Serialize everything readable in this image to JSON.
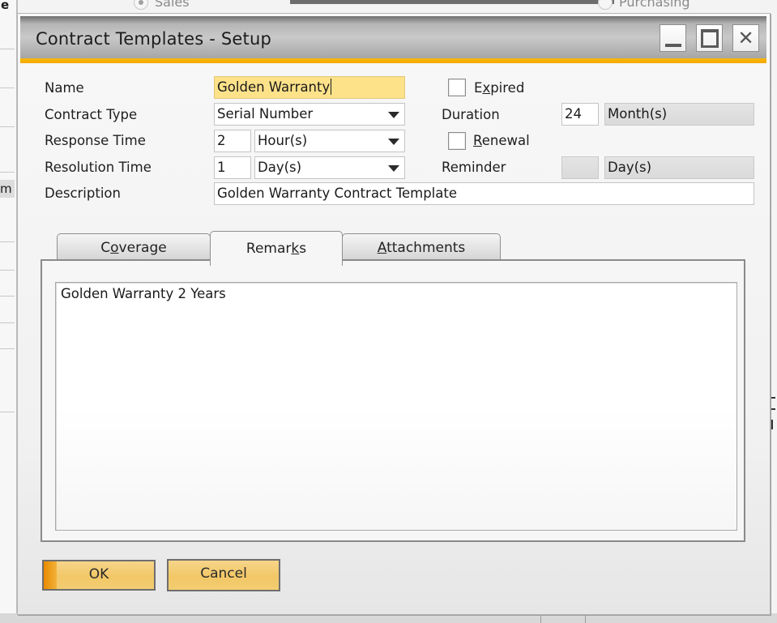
{
  "background": {
    "radio_sales": "Sales",
    "radio_purchasing": "Purchasing",
    "left_col_letter_top": "e",
    "left_col_letter_mid": "m"
  },
  "dialog": {
    "title": "Contract Templates - Setup",
    "window_controls": {
      "minimize": "minimize-icon",
      "maximize": "maximize-icon",
      "close": "close-icon"
    },
    "accent_color": "#f5a800"
  },
  "form": {
    "name": {
      "label": "Name",
      "value": "Golden Warranty"
    },
    "contract_type": {
      "label": "Contract Type",
      "value": "Serial Number"
    },
    "response_time": {
      "label": "Response Time",
      "value": "2",
      "unit": "Hour(s)"
    },
    "resolution_time": {
      "label": "Resolution Time",
      "value": "1",
      "unit": "Day(s)"
    },
    "description": {
      "label": "Description",
      "value": "Golden Warranty Contract Template"
    },
    "expired": {
      "label_pre": "E",
      "label_ul": "x",
      "label_post": "pired",
      "checked": false
    },
    "duration": {
      "label": "Duration",
      "value": "24",
      "unit": "Month(s)"
    },
    "renewal": {
      "label_ul": "R",
      "label_post": "enewal",
      "checked": false
    },
    "reminder": {
      "label": "Reminder",
      "value": "",
      "unit": "Day(s)"
    }
  },
  "tabs": {
    "coverage": {
      "pre": "C",
      "ul": "o",
      "post": "verage"
    },
    "remarks": {
      "pre": "Remar",
      "ul": "k",
      "post": "s"
    },
    "attachments": {
      "pre": "",
      "ul": "A",
      "post": "ttachments"
    },
    "active": "remarks"
  },
  "remarks": {
    "text": "Golden Warranty 2 Years"
  },
  "buttons": {
    "ok": "OK",
    "cancel": "Cancel"
  }
}
